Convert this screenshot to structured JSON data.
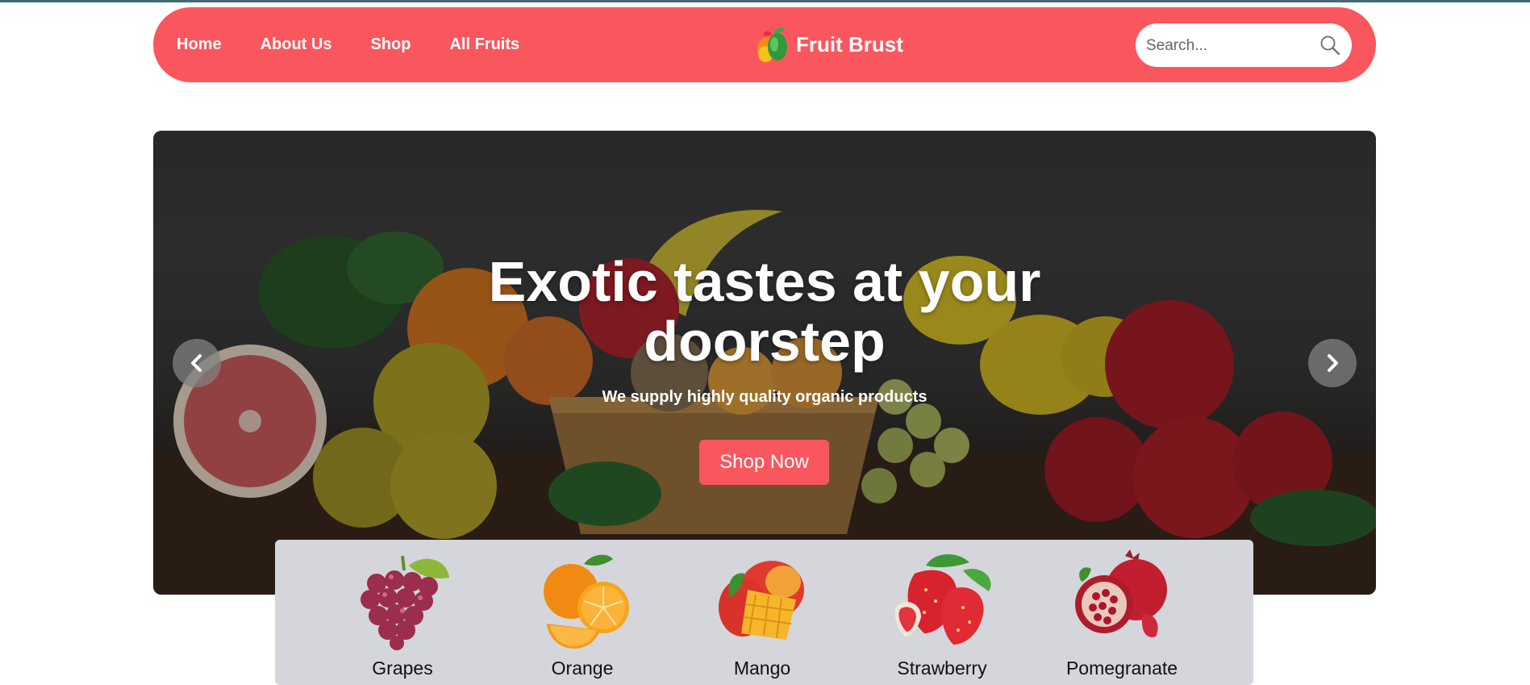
{
  "nav": {
    "links": [
      "Home",
      "About Us",
      "Shop",
      "All Fruits"
    ],
    "brand": "Fruit Brust",
    "search_placeholder": "Search..."
  },
  "hero": {
    "title": "Exotic tastes at your doorstep",
    "subtitle": "We supply highly quality organic products",
    "cta": "Shop Now"
  },
  "categories": [
    "Grapes",
    "Orange",
    "Mango",
    "Strawberry",
    "Pomegranate"
  ],
  "colors": {
    "accent": "#f9575d",
    "category_bg": "#d4d6dc"
  },
  "icons": {
    "search": "search-icon",
    "prev": "chevron-left-icon",
    "next": "chevron-right-icon",
    "logo": "fruit-logo-icon"
  }
}
